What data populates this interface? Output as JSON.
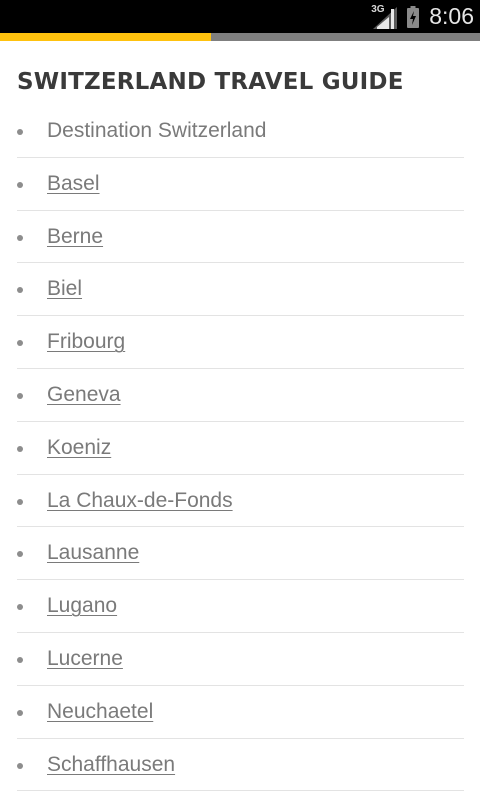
{
  "status_bar": {
    "network_type": "3G",
    "signal_icon": "signal-bars-icon",
    "battery_icon": "battery-charging-icon",
    "time": "8:06"
  },
  "page_load": {
    "progress": 0.44,
    "fill_color": "#ffc20e",
    "track_color": "#7f7f7f"
  },
  "page": {
    "title": "SWITZERLAND TRAVEL GUIDE",
    "items": [
      {
        "label": "Destination Switzerland",
        "is_link": false
      },
      {
        "label": "Basel",
        "is_link": true
      },
      {
        "label": "Berne",
        "is_link": true
      },
      {
        "label": "Biel",
        "is_link": true
      },
      {
        "label": "Fribourg",
        "is_link": true
      },
      {
        "label": "Geneva",
        "is_link": true
      },
      {
        "label": "Koeniz",
        "is_link": true
      },
      {
        "label": "La Chaux-de-Fonds",
        "is_link": true
      },
      {
        "label": "Lausanne",
        "is_link": true
      },
      {
        "label": "Lugano",
        "is_link": true
      },
      {
        "label": "Lucerne",
        "is_link": true
      },
      {
        "label": "Neuchaetel",
        "is_link": true
      },
      {
        "label": "Schaffhausen",
        "is_link": true
      }
    ]
  }
}
